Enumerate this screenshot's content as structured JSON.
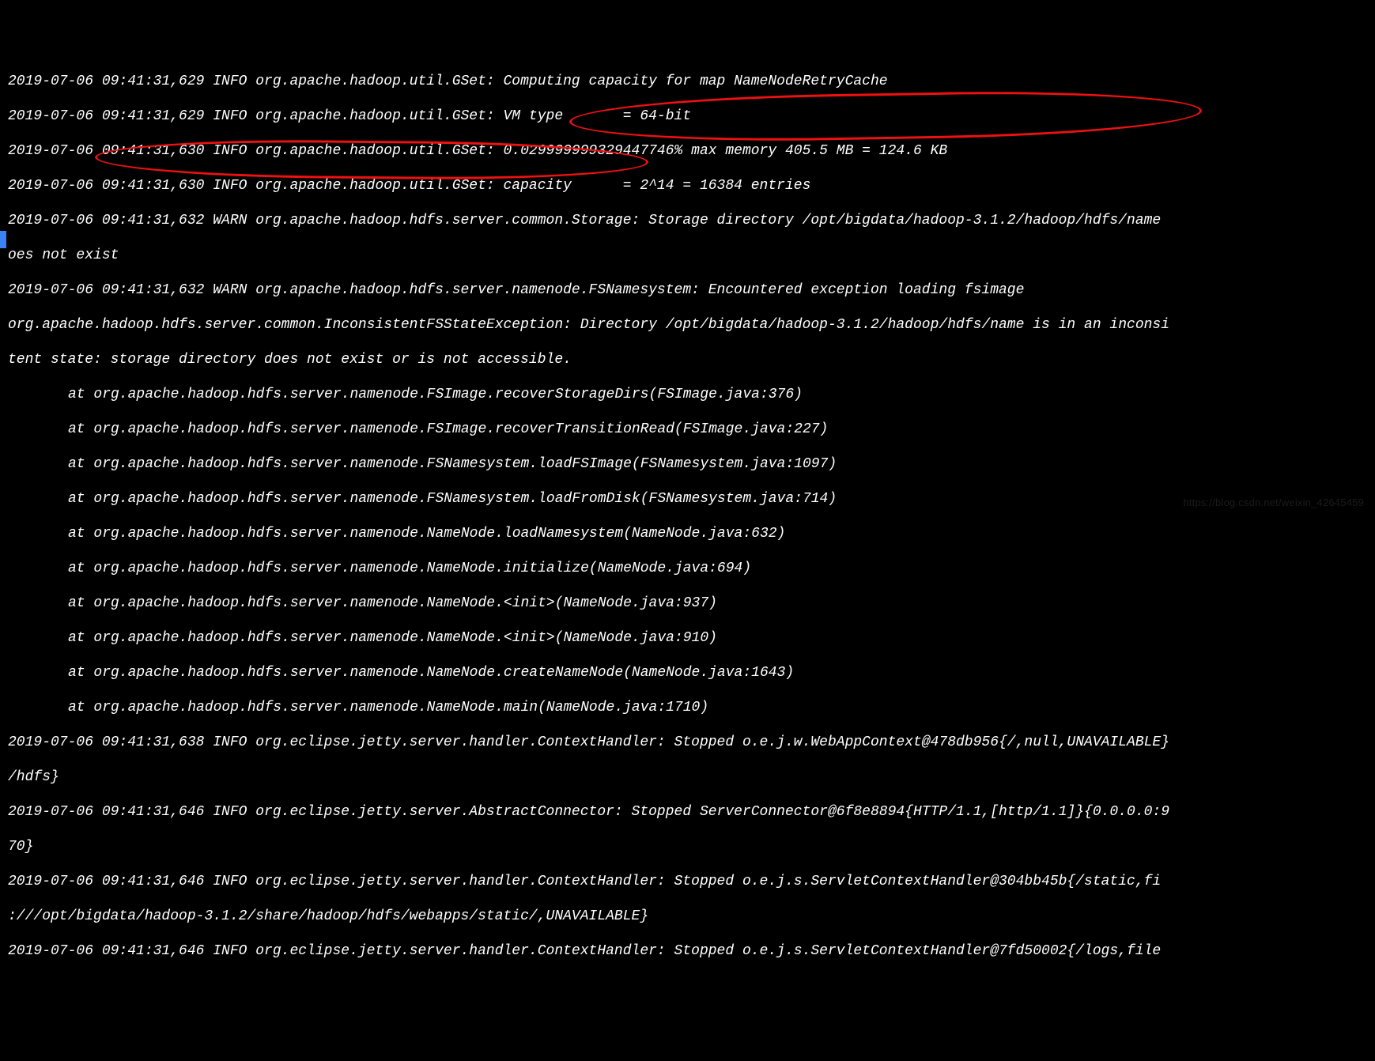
{
  "watermark": "https://blog.csdn.net/weixin_42645459",
  "lines": [
    "2019-07-06 09:41:31,629 INFO org.apache.hadoop.util.GSet: Computing capacity for map NameNodeRetryCache",
    "2019-07-06 09:41:31,629 INFO org.apache.hadoop.util.GSet: VM type       = 64-bit",
    "2019-07-06 09:41:31,630 INFO org.apache.hadoop.util.GSet: 0.029999999329447746% max memory 405.5 MB = 124.6 KB",
    "2019-07-06 09:41:31,630 INFO org.apache.hadoop.util.GSet: capacity      = 2^14 = 16384 entries",
    "2019-07-06 09:41:31,632 WARN org.apache.hadoop.hdfs.server.common.Storage: Storage directory /opt/bigdata/hadoop-3.1.2/hadoop/hdfs/name",
    "oes not exist",
    "2019-07-06 09:41:31,632 WARN org.apache.hadoop.hdfs.server.namenode.FSNamesystem: Encountered exception loading fsimage",
    "org.apache.hadoop.hdfs.server.common.InconsistentFSStateException: Directory /opt/bigdata/hadoop-3.1.2/hadoop/hdfs/name is in an inconsi",
    "tent state: storage directory does not exist or is not accessible."
  ],
  "stack": [
    "at org.apache.hadoop.hdfs.server.namenode.FSImage.recoverStorageDirs(FSImage.java:376)",
    "at org.apache.hadoop.hdfs.server.namenode.FSImage.recoverTransitionRead(FSImage.java:227)",
    "at org.apache.hadoop.hdfs.server.namenode.FSNamesystem.loadFSImage(FSNamesystem.java:1097)",
    "at org.apache.hadoop.hdfs.server.namenode.FSNamesystem.loadFromDisk(FSNamesystem.java:714)",
    "at org.apache.hadoop.hdfs.server.namenode.NameNode.loadNamesystem(NameNode.java:632)",
    "at org.apache.hadoop.hdfs.server.namenode.NameNode.initialize(NameNode.java:694)",
    "at org.apache.hadoop.hdfs.server.namenode.NameNode.<init>(NameNode.java:937)",
    "at org.apache.hadoop.hdfs.server.namenode.NameNode.<init>(NameNode.java:910)",
    "at org.apache.hadoop.hdfs.server.namenode.NameNode.createNameNode(NameNode.java:1643)",
    "at org.apache.hadoop.hdfs.server.namenode.NameNode.main(NameNode.java:1710)"
  ],
  "tail": [
    "2019-07-06 09:41:31,638 INFO org.eclipse.jetty.server.handler.ContextHandler: Stopped o.e.j.w.WebAppContext@478db956{/,null,UNAVAILABLE}",
    "/hdfs}",
    "2019-07-06 09:41:31,646 INFO org.eclipse.jetty.server.AbstractConnector: Stopped ServerConnector@6f8e8894{HTTP/1.1,[http/1.1]}{0.0.0.0:9",
    "70}",
    "2019-07-06 09:41:31,646 INFO org.eclipse.jetty.server.handler.ContextHandler: Stopped o.e.j.s.ServletContextHandler@304bb45b{/static,fi",
    ":///opt/bigdata/hadoop-3.1.2/share/hadoop/hdfs/webapps/static/,UNAVAILABLE}",
    "2019-07-06 09:41:31,646 INFO org.eclipse.jetty.server.handler.ContextHandler: Stopped o.e.j.s.ServletContextHandler@7fd50002{/logs,file"
  ]
}
